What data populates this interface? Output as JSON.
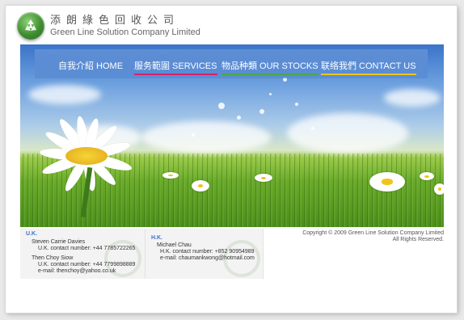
{
  "header": {
    "title_cn": "添朗綠色回收公司",
    "title_en": "Green Line Solution Company Limited",
    "logo_icon": "recycle-icon"
  },
  "nav": [
    {
      "label": "自我介紹  HOME",
      "color": "#3a7fd5"
    },
    {
      "label": "服务範圍  SERVICES",
      "color": "#d6226a"
    },
    {
      "label": "物品种類  OUR STOCKS",
      "color": "#4aa64a"
    },
    {
      "label": "联络我們  CONTACT US",
      "color": "#f0c419"
    }
  ],
  "footer": {
    "uk": {
      "heading": "U.K.",
      "person1": "Steven Carrie Davies",
      "person1_contact": "U.K. contact number: +44 7785722265",
      "person2": "Then Choy Siow",
      "person2_contact": "U.K. contact number: +44 7799898889",
      "person2_email": "e-mail: thenchoy@yahoo.co.uk"
    },
    "hk": {
      "heading": "H.K.",
      "person1": "Michael Chau",
      "person1_contact": "H.K. contact number: +852 90954989",
      "person1_email": "e-mail: chaumankwong@hotmail.com"
    },
    "copyright_line1": "Copyright © 2009 Green Line Solution Company Limited",
    "copyright_line2": "All Rights Reserved."
  }
}
